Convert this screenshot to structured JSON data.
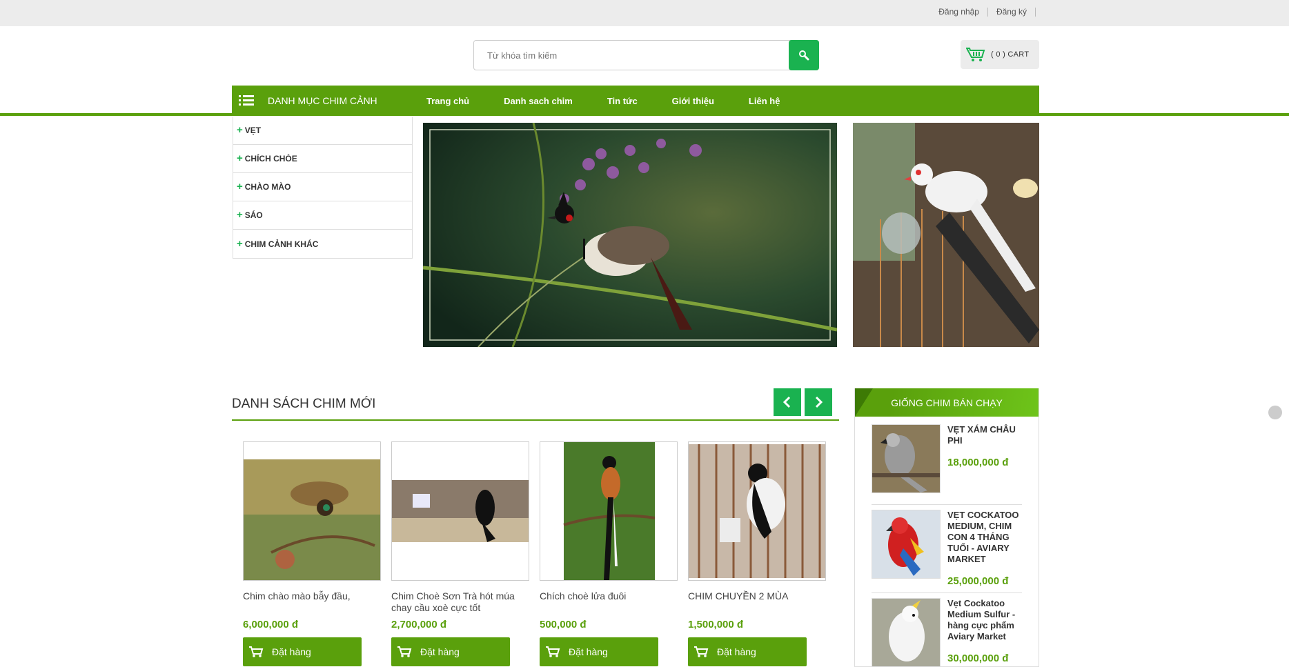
{
  "topbar": {
    "login": "Đăng nhập",
    "register": "Đăng ký"
  },
  "search": {
    "placeholder": "Từ khóa tìm kiếm"
  },
  "cart": {
    "label": "( 0 ) CART"
  },
  "nav": {
    "category_title": "DANH MỤC CHIM CẢNH",
    "links": [
      "Trang chủ",
      "Danh sach chim",
      "Tin tức",
      "Giới thiệu",
      "Liên hệ"
    ]
  },
  "sidebar": {
    "items": [
      "VẸT",
      "CHÍCH CHÒE",
      "CHÀO MÀO",
      "SÁO",
      "CHIM CẢNH KHÁC"
    ]
  },
  "new_birds": {
    "title": "DANH SÁCH CHIM MỚI",
    "order_label": "Đặt hàng",
    "products": [
      {
        "name": "Chim chào mào bẫy đầu,",
        "price": "6,000,000 đ"
      },
      {
        "name": "Chim Choè Sơn Trà hót múa chay cầu xoè cực tốt",
        "price": "2,700,000 đ"
      },
      {
        "name": "Chích choè lửa đuôi",
        "price": "500,000 đ"
      },
      {
        "name": "CHIM CHUYỀN 2 MÙA",
        "price": "1,500,000 đ"
      }
    ]
  },
  "bestseller": {
    "title": "GIỐNG CHIM BÁN CHẠY",
    "items": [
      {
        "name": "VẸT XÁM CHÂU PHI",
        "price": "18,000,000 đ"
      },
      {
        "name": "VẸT COCKATOO MEDIUM, CHIM CON 4 THÁNG TUỔI - AVIARY MARKET",
        "price": "25,000,000 đ"
      },
      {
        "name": "Vẹt Cockatoo Medium Sulfur - hàng cực phẩm Aviary Market",
        "price": "30,000,000 đ"
      }
    ]
  },
  "colors": {
    "brand_green": "#5aa00c",
    "button_green": "#1ab250",
    "topbar_bg": "#ececec"
  },
  "icons": [
    "search-icon",
    "cart-basket-icon",
    "menu-list-icon",
    "plus-icon",
    "chevron-left-icon",
    "chevron-right-icon"
  ]
}
